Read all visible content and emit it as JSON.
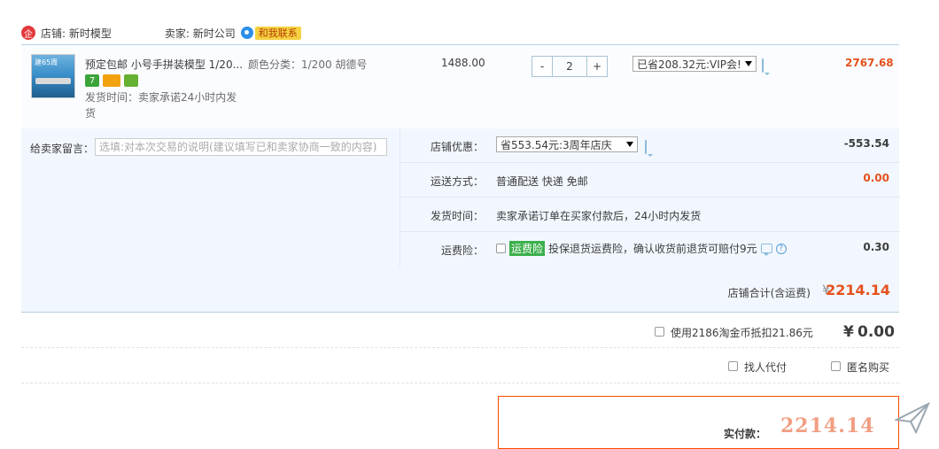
{
  "shop": {
    "badge": "企",
    "name_label": "店铺: 新时模型",
    "seller_label": "卖家: 新时公司",
    "contact_button": "和我联系"
  },
  "item": {
    "thumb_text": "建65周",
    "title": "预定包邮 小号手拼装模型 1/20...",
    "spec": "颜色分类：1/200 胡德号",
    "tags": [
      "7",
      "",
      ""
    ],
    "ship_time_line1": "发货时间：卖家承诺24小时内发",
    "ship_time_line2": "货",
    "unit_price": "1488.00",
    "qty_minus": "-",
    "qty_value": "2",
    "qty_plus": "+",
    "vip_discount": "已省208.32元:VIP会!",
    "total": "2767.68"
  },
  "order": {
    "msg_label": "给卖家留言：",
    "msg_placeholder": "选填:对本次交易的说明(建议填写已和卖家协商一致的内容)",
    "rows": [
      {
        "label": "店铺优惠：",
        "value": "省553.54元:3周年店庆",
        "amount": "-553.54"
      },
      {
        "label": "运送方式：",
        "value": "普通配送 快递 免邮",
        "amount": "0.00"
      },
      {
        "label": "发货时间：",
        "value_prefix": "卖家承诺订单在买家付款后，24小时内",
        "value_link": "发货",
        "amount": ""
      },
      {
        "label": "运费险：",
        "badge": "运费险",
        "value": "投保退货运费险，确认收货前退货可赔付9元",
        "amount": "0.30"
      }
    ],
    "subtotal_label": "店铺合计(含运费)",
    "subtotal_yen": "¥",
    "subtotal_amount": "2214.14"
  },
  "taojin": {
    "label": "使用2186淘金币抵扣21.86元",
    "yen": "¥",
    "amount": "0.00"
  },
  "options": {
    "proxy_pay": "找人代付",
    "anonymous": "匿名购买"
  },
  "pay": {
    "label": "实付款：",
    "watermark": "2214.14"
  }
}
